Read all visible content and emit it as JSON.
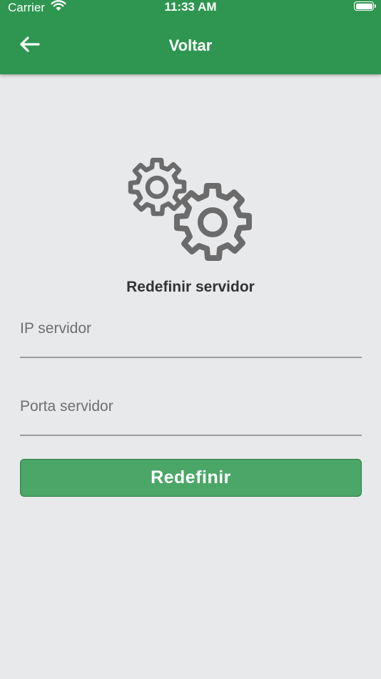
{
  "status_bar": {
    "carrier": "Carrier",
    "time": "11:33 AM",
    "wifi_icon": "wifi-icon",
    "battery_icon": "battery-icon"
  },
  "nav": {
    "back_icon": "arrow-left-icon",
    "title": "Voltar"
  },
  "colors": {
    "header_green": "#2e9650",
    "button_green": "#4aa767",
    "background": "#e8e9eb",
    "gear_gray": "#6b6b6b"
  },
  "main": {
    "icon": "gears-icon",
    "title": "Redefinir servidor",
    "ip_field": {
      "placeholder": "IP servidor",
      "value": ""
    },
    "port_field": {
      "placeholder": "Porta servidor",
      "value": ""
    },
    "submit_label": "Redefinir"
  }
}
